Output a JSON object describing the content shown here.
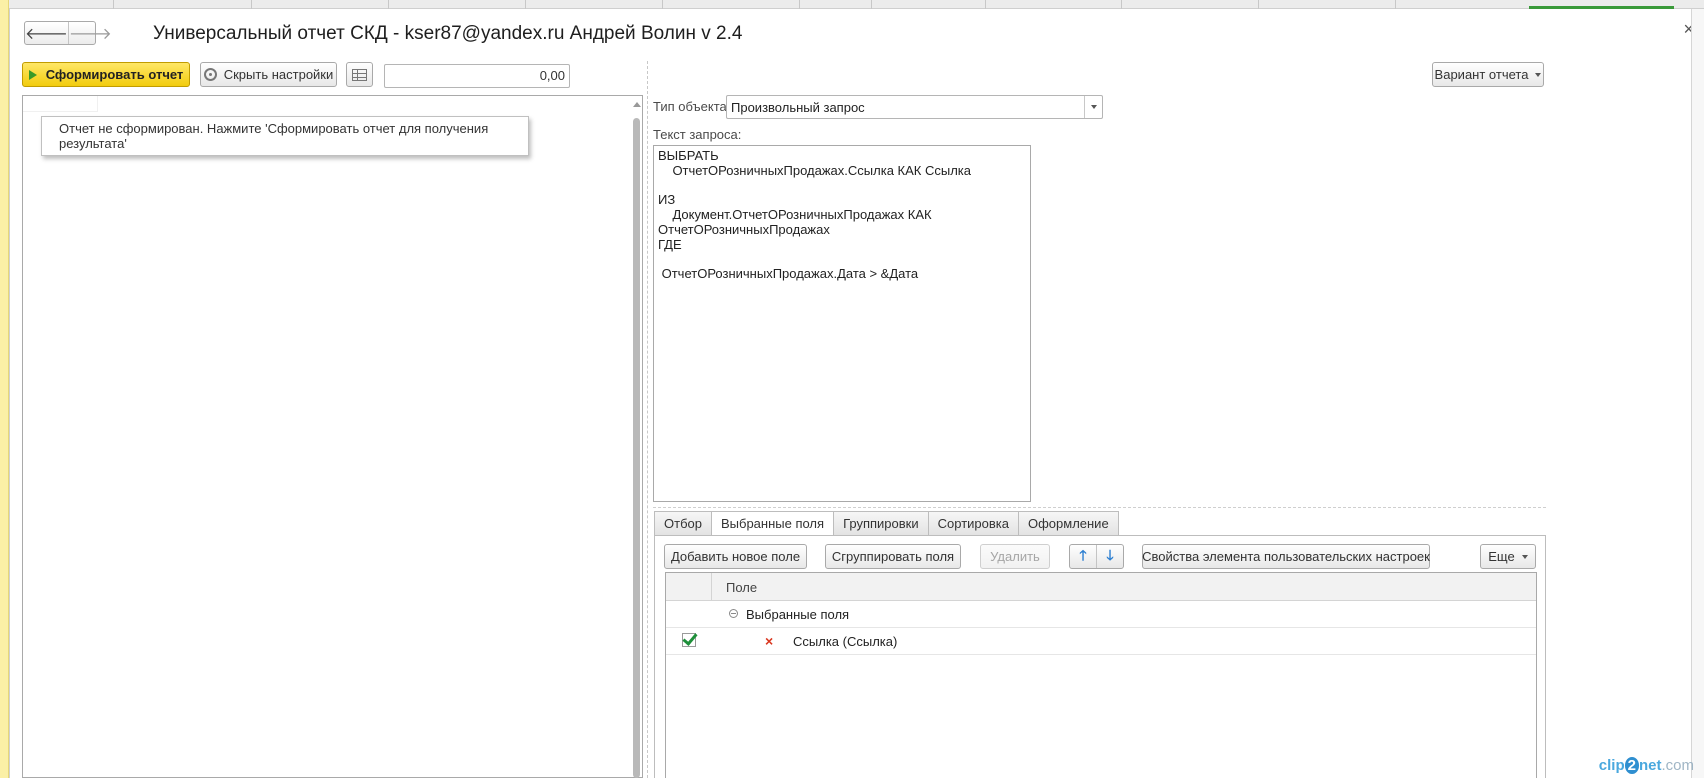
{
  "window": {
    "title": "Универсальный отчет СКД - kser87@yandex.ru Андрей Волин v 2.4",
    "close_glyph": "×",
    "back_glyph": "🡐",
    "forward_glyph": "🡒"
  },
  "toolbar": {
    "generate_label": "Сформировать отчет",
    "hide_settings_label": "Скрыть настройки",
    "amount_value": "0,00",
    "variant_label": "Вариант отчета"
  },
  "report": {
    "message": "Отчет не сформирован. Нажмите 'Сформировать отчет для получения результата'"
  },
  "settings": {
    "object_type_label": "Тип объекта:",
    "object_type_value": "Произвольный запрос",
    "query_label": "Текст запроса:",
    "query_text": "ВЫБРАТЬ\n    ОтчетОРозничныхПродажах.Ссылка КАК Ссылка\n\nИЗ\n    Документ.ОтчетОРозничныхПродажах КАК\nОтчетОРозничныхПродажах\nГДЕ\n\n ОтчетОРозничныхПродажах.Дата > &Дата"
  },
  "tabs": [
    {
      "label": "Отбор"
    },
    {
      "label": "Выбранные поля"
    },
    {
      "label": "Группировки"
    },
    {
      "label": "Сортировка"
    },
    {
      "label": "Оформление"
    }
  ],
  "fields_panel": {
    "add_field_label": "Добавить новое поле",
    "group_fields_label": "Сгруппировать поля",
    "delete_label": "Удалить",
    "up_glyph": "🡑",
    "down_glyph": "🡓",
    "properties_label": "Свойства элемента пользовательских настроек",
    "more_label": "Еще",
    "column_header": "Поле",
    "group_row_label": "Выбранные поля",
    "field_row_label": "Ссылка (Ссылка)",
    "delete_glyph": "×"
  },
  "watermark": {
    "part1": "clip",
    "part2": "2",
    "part3": "net",
    "part4": ".com"
  },
  "colors": {
    "primary_button": "#f2cc0e",
    "check_green": "#1e8f3a",
    "delete_red": "#d9351e",
    "arrow_blue": "#2d7fd1"
  }
}
